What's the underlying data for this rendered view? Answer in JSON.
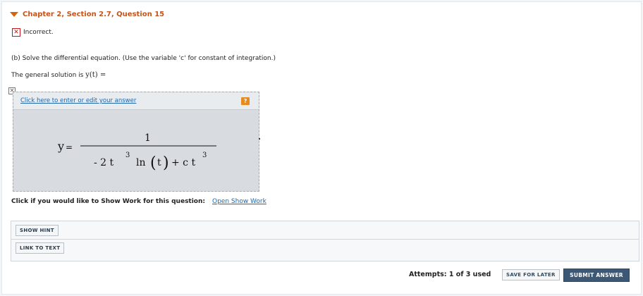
{
  "header": {
    "title": "Chapter 2, Section 2.7, Question 15"
  },
  "status": {
    "text": "Incorrect."
  },
  "question": {
    "part_text": "(b) Solve the differential equation. (Use the variable 'c' for constant of integration.)",
    "general_solution_label": "The general solution is ",
    "general_solution_math": "y(t) ="
  },
  "answer": {
    "edit_link": "Click here to enter or edit your answer",
    "help_icon_label": "?",
    "formula": {
      "lhs": "y",
      "equals": "=",
      "numerator": "1",
      "denominator_parts": [
        "- 2 t",
        "3",
        "ln",
        "(",
        "t",
        ")",
        "+ c t",
        "3"
      ]
    }
  },
  "show_work": {
    "label": "Click if you would like to Show Work for this question:",
    "link": "Open Show Work"
  },
  "buttons": {
    "show_hint": "SHOW HINT",
    "link_to_text": "LINK TO TEXT",
    "save_for_later": "SAVE FOR LATER",
    "submit_answer": "SUBMIT ANSWER"
  },
  "attempts": {
    "text": "Attempts: 1 of 3 used"
  },
  "colors": {
    "header_accent": "#c4541a",
    "incorrect_red": "#c21818",
    "link_blue": "#2266aa",
    "submit_bg": "#3d5875",
    "answer_bg": "#d8dce1"
  }
}
